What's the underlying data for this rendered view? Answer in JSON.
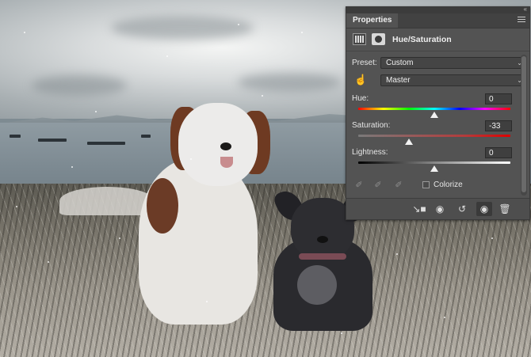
{
  "panel": {
    "tab_label": "Properties",
    "adjustment_title": "Hue/Saturation",
    "preset_label": "Preset:",
    "preset_value": "Custom",
    "channel_value": "Master",
    "colorize_label": "Colorize",
    "colorize_checked": false
  },
  "sliders": {
    "hue": {
      "label": "Hue:",
      "value": "0",
      "min": -180,
      "max": 180
    },
    "saturation": {
      "label": "Saturation:",
      "value": "-33",
      "min": -100,
      "max": 100
    },
    "lightness": {
      "label": "Lightness:",
      "value": "0",
      "min": -100,
      "max": 100
    }
  },
  "icons": {
    "adjustment": "hue-saturation-adjustment-icon",
    "mask": "layer-mask-icon",
    "target": "targeted-adjustment-hand-icon",
    "eyedroppers": [
      "eyedropper-icon",
      "eyedropper-plus-icon",
      "eyedropper-minus-icon"
    ],
    "footer": [
      "clip-to-layer-icon",
      "view-previous-state-icon",
      "reset-icon",
      "visibility-eye-icon",
      "trash-icon"
    ]
  },
  "colors": {
    "panel_bg": "#535353",
    "tab_bar_bg": "#424242",
    "thumb": "#f2f2f2"
  }
}
